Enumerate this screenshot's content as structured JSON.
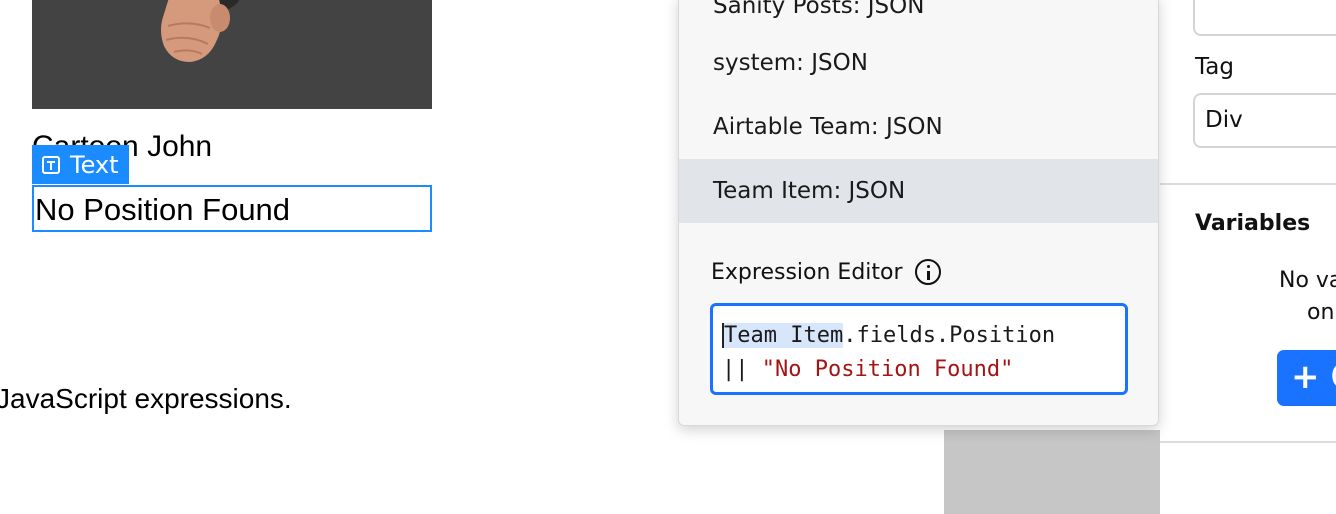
{
  "canvas": {
    "card_name": "Cartoon John",
    "badge_label": "Text",
    "selected_text": "No Position Found",
    "footer_text": "JavaScript expressions."
  },
  "popover": {
    "items": [
      {
        "label": "Sanity Posts: JSON",
        "active": false
      },
      {
        "label": "system: JSON",
        "active": false
      },
      {
        "label": "Airtable Team: JSON",
        "active": false
      },
      {
        "label": "Team Item: JSON",
        "active": true
      }
    ],
    "expression_label": "Expression Editor",
    "expression": {
      "token_highlight": "Team Item",
      "token_rest": ".fields.Position",
      "operator": "|| ",
      "string_literal": "\"No Position Found\""
    }
  },
  "right_panel": {
    "tag_label": "Tag",
    "tag_value": "Div",
    "variables_title": "Variables",
    "empty_text_line1": "No va",
    "empty_text_line2": "on",
    "add_button_label": "C"
  },
  "colors": {
    "accent": "#1a8cff",
    "button": "#1a73ff",
    "string_literal": "#a31515",
    "active_row": "#e1e4e8"
  }
}
